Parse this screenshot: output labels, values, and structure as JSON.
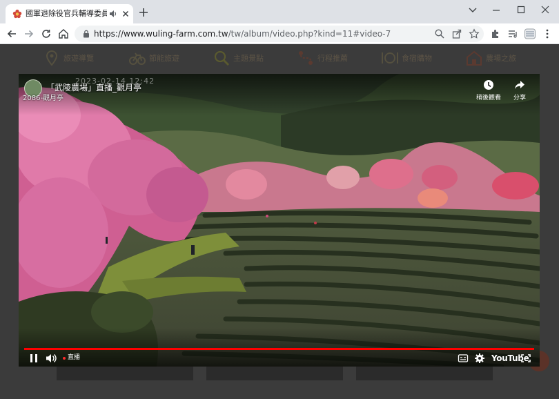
{
  "browser": {
    "tab": {
      "title": "國軍退除役官兵輔導委員會武",
      "favicon": "flower-icon"
    },
    "url": {
      "host": "https://www.wuling-farm.com.tw",
      "path": "/tw/album/video.php?kind=11#video-7"
    },
    "toolbar_icons": [
      "back-icon",
      "forward-icon",
      "reload-icon",
      "home-icon",
      "lock-icon",
      "zoom-icon",
      "share-icon",
      "bookmark-star-icon",
      "extensions-icon",
      "media-queue-icon",
      "profile-icon",
      "menu-icon"
    ]
  },
  "site_nav": {
    "items": [
      {
        "label": "旅遊導覽",
        "icon": "map-pin-icon"
      },
      {
        "label": "節能旅遊",
        "icon": "bike-icon"
      },
      {
        "label": "主題景點",
        "icon": "magnifier-icon"
      },
      {
        "label": "行程推薦",
        "icon": "route-icon"
      },
      {
        "label": "食宿購物",
        "icon": "dining-icon"
      },
      {
        "label": "農場之旅",
        "icon": "house-icon"
      }
    ]
  },
  "video": {
    "title": "「武陵農場」直播_觀月亭",
    "timestamp": "2023-02-14 12:42",
    "camera_label": "2086-觀月亭",
    "watch_later_label": "稍後觀看",
    "share_label": "分享",
    "live_label": "直播",
    "brand": "YouTube",
    "progress_fraction": 1.0,
    "accent_color": "#ff0000"
  }
}
